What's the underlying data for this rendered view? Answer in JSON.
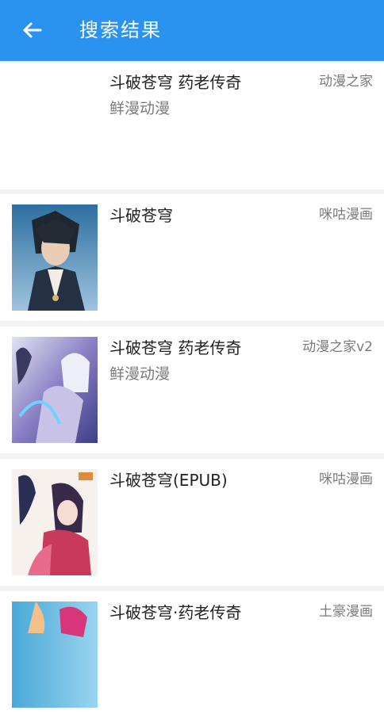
{
  "appbar": {
    "title": "搜索结果",
    "back_icon": "arrow-left-icon",
    "color": "#2a93f0"
  },
  "results": [
    {
      "name": "斗破苍穹 药老传奇",
      "subtitle": "鲜漫动漫",
      "source": "动漫之家"
    },
    {
      "name": "斗破苍穹",
      "subtitle": "",
      "source": "咪咕漫画"
    },
    {
      "name": "斗破苍穹 药老传奇",
      "subtitle": "鲜漫动漫",
      "source": "动漫之家v2"
    },
    {
      "name": "斗破苍穹(EPUB)",
      "subtitle": "",
      "source": "咪咕漫画"
    },
    {
      "name": "斗破苍穹·药老传奇",
      "subtitle": "",
      "source": "土豪漫画"
    }
  ]
}
